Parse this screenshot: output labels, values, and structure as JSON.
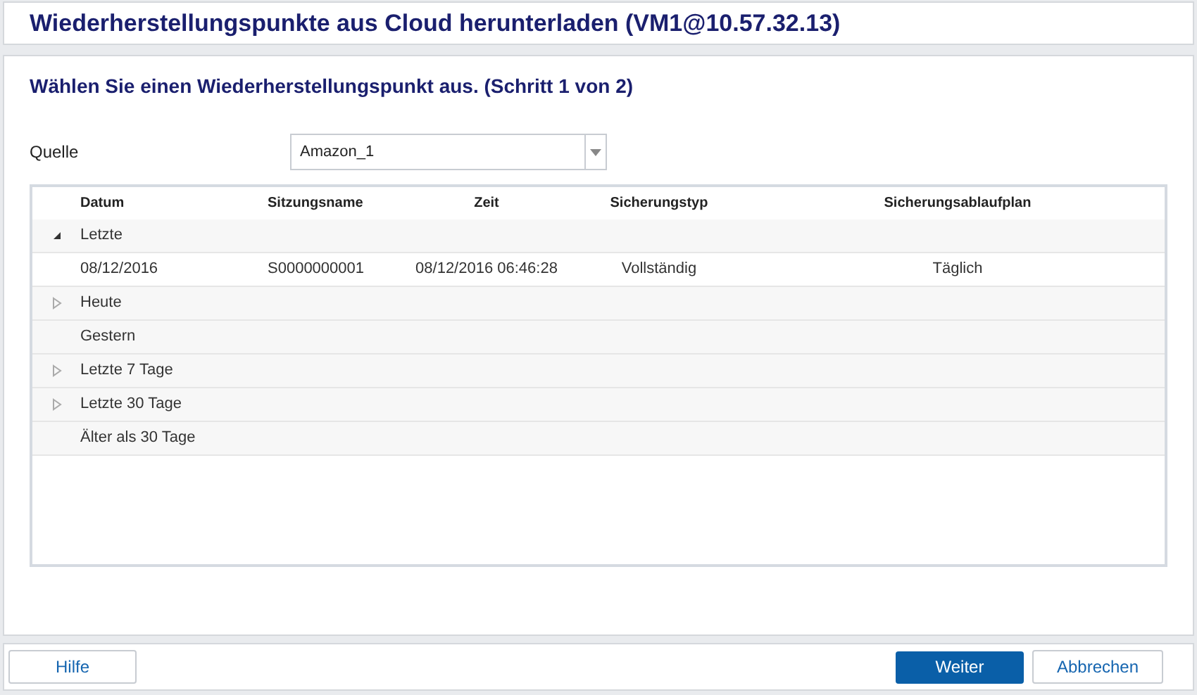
{
  "window": {
    "title": "Wiederherstellungspunkte aus Cloud herunterladen (VM1@10.57.32.13)"
  },
  "step_title": "Wählen Sie einen Wiederherstellungspunkt aus. (Schritt 1 von 2)",
  "source": {
    "label": "Quelle",
    "value": "Amazon_1"
  },
  "table": {
    "columns": [
      "Datum",
      "Sitzungsname",
      "Zeit",
      "Sicherungstyp",
      "Sicherungsablaufplan"
    ],
    "rows": [
      {
        "kind": "group",
        "label": "Letzte",
        "expanded": true
      },
      {
        "kind": "record",
        "cells": [
          "08/12/2016",
          "S0000000001",
          "08/12/2016 06:46:28",
          "Vollständig",
          "Täglich"
        ]
      },
      {
        "kind": "group",
        "label": "Heute",
        "expanded": false
      },
      {
        "kind": "empty",
        "label": "Gestern"
      },
      {
        "kind": "group",
        "label": "Letzte 7 Tage",
        "expanded": false
      },
      {
        "kind": "group",
        "label": "Letzte 30 Tage",
        "expanded": false
      },
      {
        "kind": "empty",
        "label": "Älter als 30 Tage"
      }
    ]
  },
  "buttons": {
    "help": "Hilfe",
    "next": "Weiter",
    "cancel": "Abbrechen"
  }
}
